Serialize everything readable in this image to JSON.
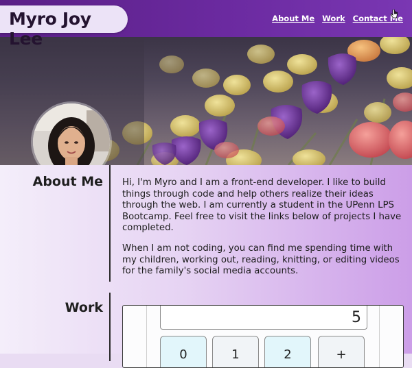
{
  "header": {
    "name": "Myro Joy Lee",
    "nav": [
      "About Me",
      "Work",
      "Contact Me"
    ]
  },
  "about": {
    "title": "About Me",
    "paragraphs": [
      "Hi, I'm Myro and I am a front-end developer. I like to build things through code and help others realize their ideas through the web. I am currently a student in the UPenn LPS Bootcamp. Feel free to visit the links below of projects I have completed.",
      "When I am not coding, you can find me spending time with my children, working out, reading, knitting, or editing videos for the family's social media accounts."
    ]
  },
  "work": {
    "title": "Work",
    "calculator": {
      "display_value": "5",
      "keys": [
        "0",
        "1",
        "2",
        "+"
      ]
    }
  },
  "colors": {
    "header_purple": "#5a1f86",
    "accent_lavender": "#cc9ee8"
  }
}
